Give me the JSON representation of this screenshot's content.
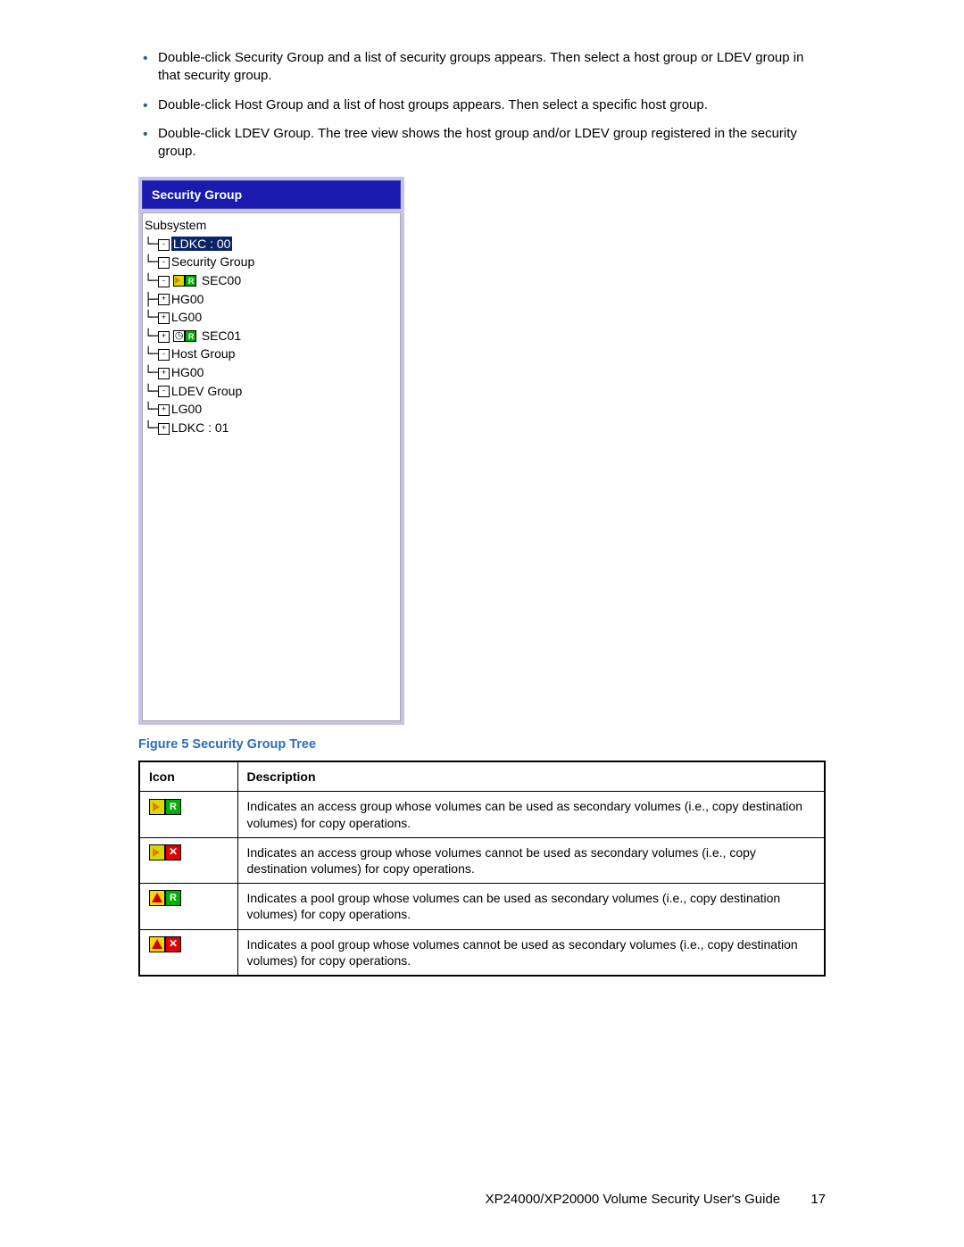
{
  "bullets": [
    "Double-click Security Group and a list of security groups appears. Then select a host group or LDEV group in that security group.",
    "Double-click Host Group and a list of host groups appears. Then select a specific host group.",
    "Double-click LDEV Group. The tree view shows the host group and/or LDEV group registered in the security group."
  ],
  "tree": {
    "title": "Security Group",
    "nodes": [
      {
        "prefix": "",
        "label": "Subsystem"
      },
      {
        "prefix": " └─",
        "label": "LDKC : 00",
        "selected": true,
        "box": "-"
      },
      {
        "prefix": "    └─",
        "label": "Security Group",
        "box": "-"
      },
      {
        "prefix": "       └─",
        "label": "SEC00",
        "icon": "access-green",
        "box": "-"
      },
      {
        "prefix": "          ├─",
        "label": "HG00",
        "box": "+"
      },
      {
        "prefix": "          └─",
        "label": "LG00",
        "box": "+"
      },
      {
        "prefix": "       └─",
        "label": "SEC01",
        "icon": "clock-green",
        "box": "+"
      },
      {
        "prefix": "    └─",
        "label": "Host Group",
        "box": "-"
      },
      {
        "prefix": "       └─",
        "label": "HG00",
        "box": "+"
      },
      {
        "prefix": "    └─",
        "label": "LDEV Group",
        "box": "-"
      },
      {
        "prefix": "       └─",
        "label": "LG00",
        "box": "+"
      },
      {
        "prefix": " └─",
        "label": "LDKC : 01",
        "box": "+"
      }
    ]
  },
  "figure_caption": "Figure 5 Security Group Tree",
  "table": {
    "headers": {
      "icon": "Icon",
      "desc": "Description"
    },
    "rows": [
      {
        "icon": "access-green",
        "desc": "Indicates an access group whose volumes can be used as secondary volumes (i.e., copy destination volumes) for copy operations."
      },
      {
        "icon": "access-red",
        "desc": "Indicates an access group whose volumes cannot be used as secondary volumes (i.e., copy destination volumes) for copy operations."
      },
      {
        "icon": "pool-green",
        "desc": "Indicates a pool group whose volumes can be used as secondary volumes (i.e., copy destination volumes) for copy operations."
      },
      {
        "icon": "pool-red",
        "desc": "Indicates a pool group whose volumes cannot be used as secondary volumes (i.e., copy destination volumes) for copy operations."
      }
    ]
  },
  "footer": {
    "text": "XP24000/XP20000 Volume Security User's Guide",
    "page": "17"
  }
}
